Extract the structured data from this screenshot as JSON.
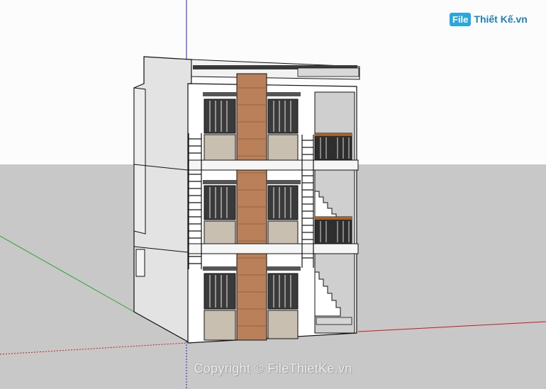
{
  "watermark": {
    "logo_mark": "File",
    "logo_text": "Thiết Kế.vn",
    "copyright": "Copyright © FileThietKe.vn"
  },
  "colors": {
    "sky": "#fcfcfc",
    "ground": "#c8c8c8",
    "wall": "#ffffff",
    "side_wall": "#e2e2e2",
    "wood_column": "#b9805a",
    "stone": "#c9bfb0",
    "window_dark": "#3a3a3a",
    "axis_red": "#c41c1c",
    "axis_green": "#2aa42a",
    "axis_blue": "#2323b8"
  }
}
